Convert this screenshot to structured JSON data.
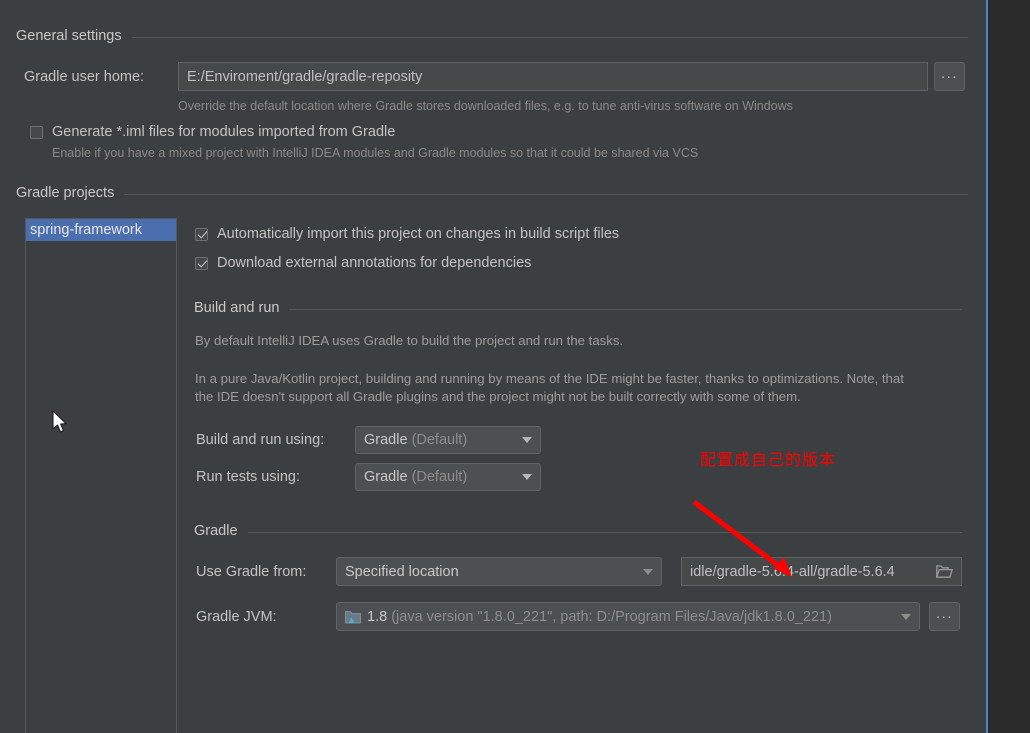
{
  "window": {
    "top_cut_text": "",
    "accent_blue": "#4a88c7",
    "background": "#3c3f41",
    "selection_blue": "#4b6eaf",
    "annotation_red": "#ff0000"
  },
  "general_settings": {
    "section_title": "General settings",
    "gradle_user_home": {
      "label": "Gradle user home:",
      "value": "E:/Enviroment/gradle/gradle-reposity",
      "placeholder": "",
      "hint": "Override the default location where Gradle stores downloaded files, e.g. to tune anti-virus software on Windows",
      "browse_label": "..."
    },
    "generate_iml": {
      "label": "Generate *.iml files for modules imported from Gradle",
      "checked": false,
      "hint": "Enable if you have a mixed project with IntelliJ IDEA modules and Gradle modules so that it could be shared via VCS"
    }
  },
  "gradle_projects": {
    "section_title": "Gradle projects",
    "project_list": [
      {
        "label": "spring-framework",
        "selected": true
      }
    ],
    "options": [
      {
        "label": "Automatically import this project on changes in build script files",
        "checked": true
      },
      {
        "label": "Download external annotations for dependencies",
        "checked": true
      }
    ]
  },
  "build_and_run": {
    "section_title": "Build and run",
    "paragraph_1": "By default IntelliJ IDEA uses Gradle to build the project and run the tasks.",
    "paragraph_2a": "In a pure Java/Kotlin project, building and running by means of the IDE might be faster, thanks to optimizations. Note, that",
    "paragraph_2b": "the IDE doesn't support all Gradle plugins and the project might not be built correctly with some of them.",
    "build_using": {
      "label": "Build and run using:",
      "value": "Gradle",
      "value_suffix": "(Default)"
    },
    "tests_using": {
      "label": "Run tests using:",
      "value": "Gradle",
      "value_suffix": "(Default)"
    }
  },
  "gradle": {
    "section_title": "Gradle",
    "use_gradle_from": {
      "label": "Use Gradle from:",
      "value": "Specified location"
    },
    "gradle_location": {
      "value": "idle/gradle-5.6.4-all/gradle-5.6.4",
      "icon": "folder-icon"
    },
    "gradle_jvm": {
      "label": "Gradle JVM:",
      "value": "1.8",
      "value_detail": "(java version \"1.8.0_221\", path: D:/Program Files/Java/jdk1.8.0_221)",
      "icon": "jdk-folder-icon",
      "browse_label": "..."
    }
  },
  "annotation": {
    "text": "配置成自己的版本",
    "color": "#ff0000"
  }
}
